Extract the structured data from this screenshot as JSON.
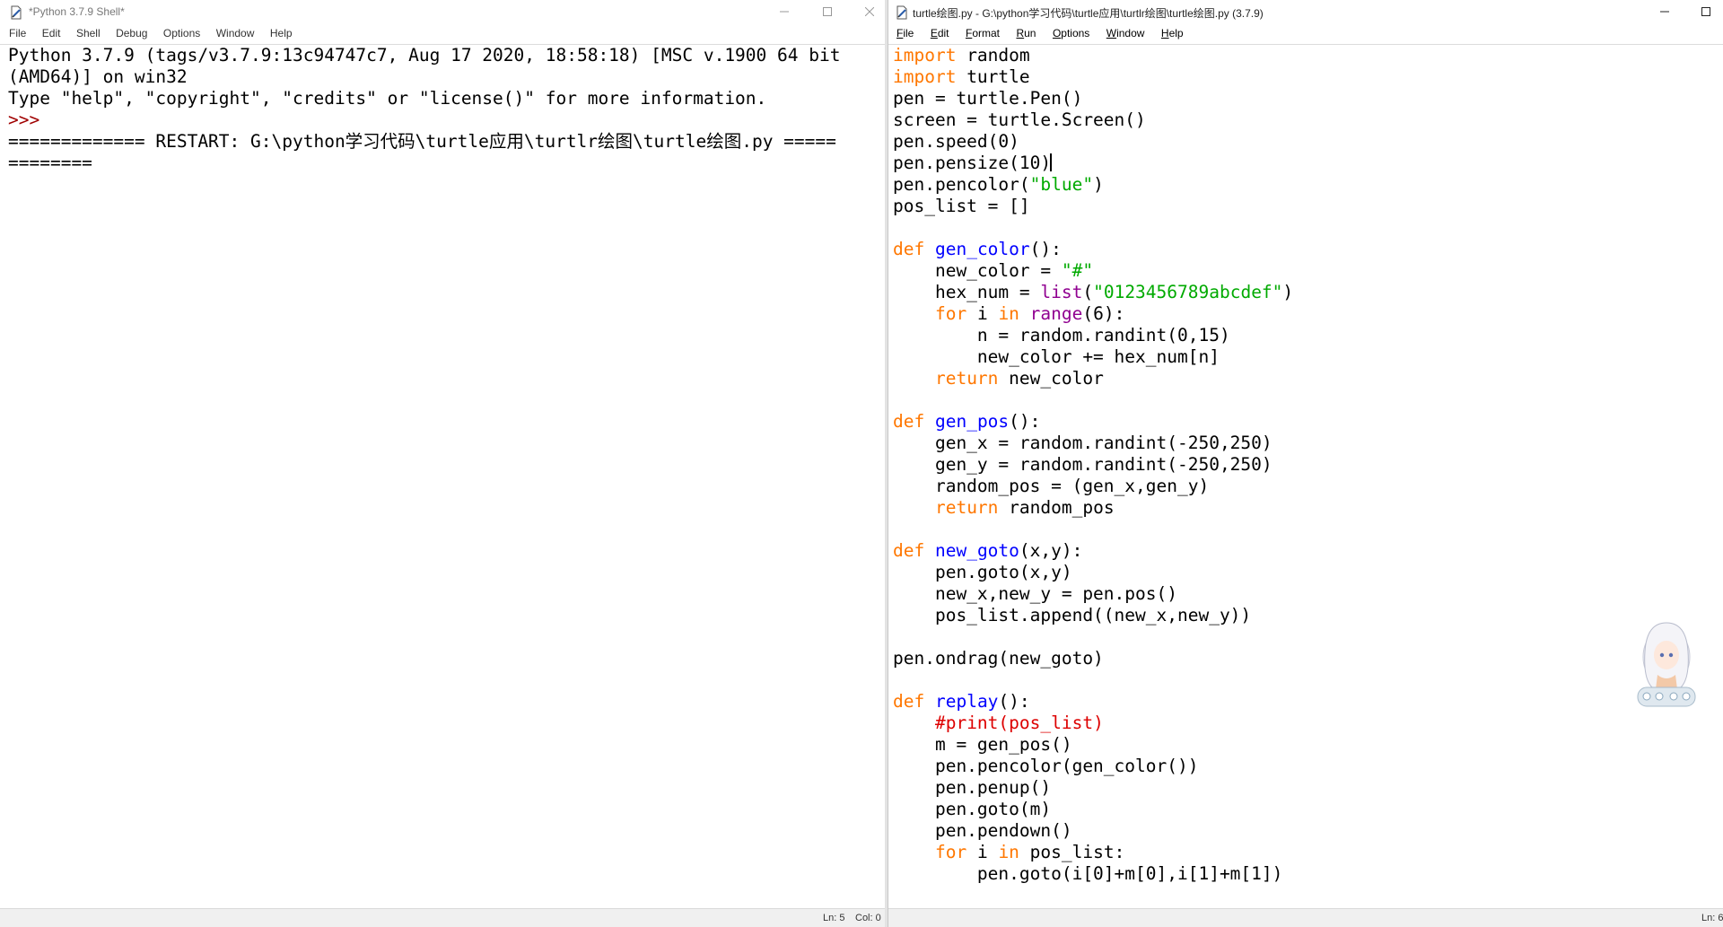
{
  "shell": {
    "title": "*Python 3.7.9 Shell*",
    "menu": [
      "File",
      "Edit",
      "Shell",
      "Debug",
      "Options",
      "Window",
      "Help"
    ],
    "lines": [
      "Python 3.7.9 (tags/v3.7.9:13c94747c7, Aug 17 2020, 18:58:18) [MSC v.1900 64 bit",
      "(AMD64)] on win32",
      "Type \"help\", \"copyright\", \"credits\" or \"license()\" for more information.",
      ">>> ",
      "============= RESTART: G:\\python学习代码\\turtle应用\\turtlr绘图\\turtle绘图.py =====",
      "========"
    ],
    "status": {
      "ln": "Ln: 5",
      "col": "Col: 0"
    }
  },
  "editor": {
    "title": "turtle绘图.py - G:\\python学习代码\\turtle应用\\turtlr绘图\\turtle绘图.py (3.7.9)",
    "menu": [
      "File",
      "Edit",
      "Format",
      "Run",
      "Options",
      "Window",
      "Help"
    ],
    "status": {
      "ln": "Ln: 6"
    }
  },
  "window_controls": {
    "minimize": "—",
    "maximize": "☐",
    "close": "✕"
  },
  "code": [
    [
      [
        "kw",
        "import"
      ],
      [
        "t",
        " random"
      ]
    ],
    [
      [
        "kw",
        "import"
      ],
      [
        "t",
        " turtle"
      ]
    ],
    [
      [
        "t",
        "pen = turtle.Pen()"
      ]
    ],
    [
      [
        "t",
        "screen = turtle.Screen()"
      ]
    ],
    [
      [
        "t",
        "pen.speed(0)"
      ]
    ],
    [
      [
        "t",
        "pen.pensize(10)"
      ],
      [
        "caret",
        ""
      ]
    ],
    [
      [
        "t",
        "pen.pencolor("
      ],
      [
        "str",
        "\"blue\""
      ],
      [
        "t",
        ")"
      ]
    ],
    [
      [
        "t",
        "pos_list = []"
      ]
    ],
    [],
    [
      [
        "kw",
        "def"
      ],
      [
        "t",
        " "
      ],
      [
        "def",
        "gen_color"
      ],
      [
        "t",
        "():"
      ]
    ],
    [
      [
        "t",
        "    new_color = "
      ],
      [
        "str",
        "\"#\""
      ]
    ],
    [
      [
        "t",
        "    hex_num = "
      ],
      [
        "bi",
        "list"
      ],
      [
        "t",
        "("
      ],
      [
        "str",
        "\"0123456789abcdef\""
      ],
      [
        "t",
        ")"
      ]
    ],
    [
      [
        "t",
        "    "
      ],
      [
        "kw",
        "for"
      ],
      [
        "t",
        " i "
      ],
      [
        "kw",
        "in"
      ],
      [
        "t",
        " "
      ],
      [
        "bi",
        "range"
      ],
      [
        "t",
        "(6):"
      ]
    ],
    [
      [
        "t",
        "        n = random.randint(0,15)"
      ]
    ],
    [
      [
        "t",
        "        new_color += hex_num[n]"
      ]
    ],
    [
      [
        "t",
        "    "
      ],
      [
        "kw",
        "return"
      ],
      [
        "t",
        " new_color"
      ]
    ],
    [],
    [
      [
        "kw",
        "def"
      ],
      [
        "t",
        " "
      ],
      [
        "def",
        "gen_pos"
      ],
      [
        "t",
        "():"
      ]
    ],
    [
      [
        "t",
        "    gen_x = random.randint(-250,250)"
      ]
    ],
    [
      [
        "t",
        "    gen_y = random.randint(-250,250)"
      ]
    ],
    [
      [
        "t",
        "    random_pos = (gen_x,gen_y)"
      ]
    ],
    [
      [
        "t",
        "    "
      ],
      [
        "kw",
        "return"
      ],
      [
        "t",
        " random_pos"
      ]
    ],
    [],
    [
      [
        "kw",
        "def"
      ],
      [
        "t",
        " "
      ],
      [
        "def",
        "new_goto"
      ],
      [
        "t",
        "(x,y):"
      ]
    ],
    [
      [
        "t",
        "    pen.goto(x,y)"
      ]
    ],
    [
      [
        "t",
        "    new_x,new_y = pen.pos()"
      ]
    ],
    [
      [
        "t",
        "    pos_list.append((new_x,new_y))"
      ]
    ],
    [],
    [
      [
        "t",
        "pen.ondrag(new_goto)"
      ]
    ],
    [],
    [
      [
        "kw",
        "def"
      ],
      [
        "t",
        " "
      ],
      [
        "def",
        "replay"
      ],
      [
        "t",
        "():"
      ]
    ],
    [
      [
        "t",
        "    "
      ],
      [
        "cmt",
        "#print(pos_list)"
      ]
    ],
    [
      [
        "t",
        "    m = gen_pos()"
      ]
    ],
    [
      [
        "t",
        "    pen.pencolor(gen_color())"
      ]
    ],
    [
      [
        "t",
        "    pen.penup()"
      ]
    ],
    [
      [
        "t",
        "    pen.goto(m)"
      ]
    ],
    [
      [
        "t",
        "    pen.pendown()"
      ]
    ],
    [
      [
        "t",
        "    "
      ],
      [
        "kw",
        "for"
      ],
      [
        "t",
        " i "
      ],
      [
        "kw",
        "in"
      ],
      [
        "t",
        " pos_list:"
      ]
    ],
    [
      [
        "t",
        "        pen.goto(i[0]+m[0],i[1]+m[1])"
      ]
    ]
  ],
  "colors": {
    "keyword": "#ff7700",
    "definition": "#0000ff",
    "builtin": "#900090",
    "string": "#00aa00",
    "comment": "#dd0000",
    "prompt": "#a00000"
  },
  "mascot_icon": "anime-girl-ime-icon"
}
